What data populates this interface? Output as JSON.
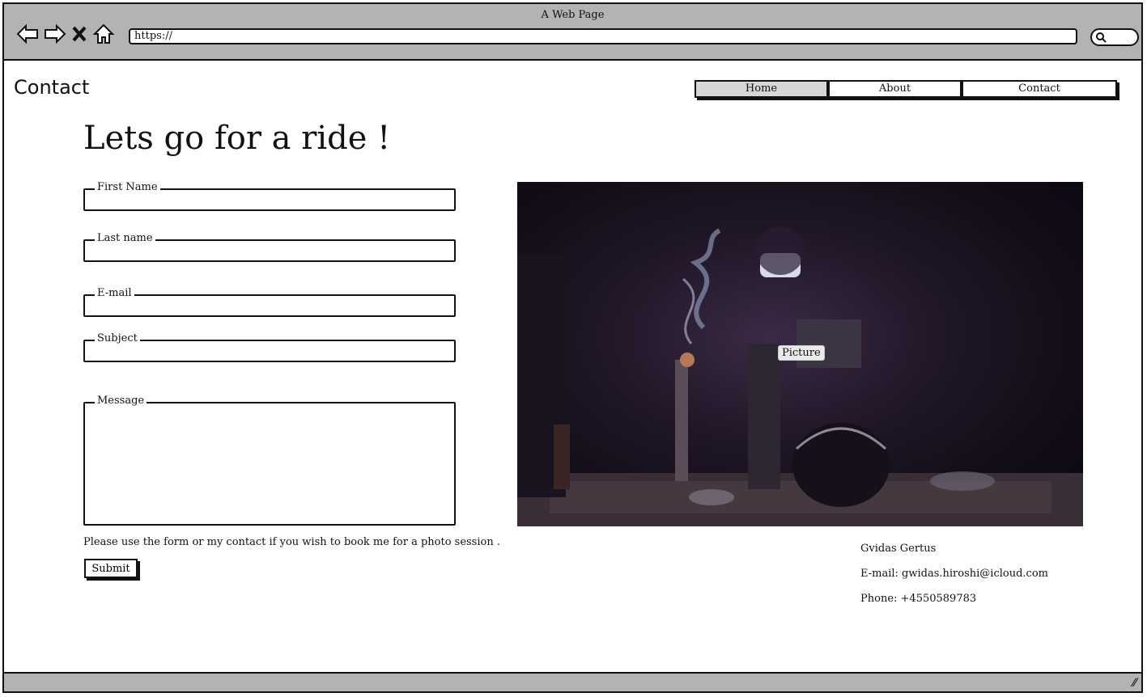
{
  "window": {
    "title": "A Web Page",
    "url": "https://"
  },
  "header": {
    "page_title": "Contact",
    "nav": [
      {
        "label": "Home",
        "active": true
      },
      {
        "label": "About",
        "active": false
      },
      {
        "label": "Contact",
        "active": false
      }
    ]
  },
  "main": {
    "heading": "Lets go for a ride !",
    "form": {
      "first_name_label": "First Name",
      "last_name_label": "Last name",
      "email_label": "E-mail",
      "subject_label": "Subject",
      "message_label": "Message",
      "note": "Please use the form or my contact if you wish to book me for a photo session .",
      "submit_label": "Submit"
    },
    "picture": {
      "label": "Picture"
    },
    "contact": {
      "name": "Gvidas Gertus",
      "email": "E-mail: gwidas.hiroshi@icloud.com",
      "phone": "Phone: +4550589783"
    }
  },
  "colors": {
    "chrome": "#b3b3b3",
    "active_tab": "#d6d6d6",
    "border": "#111111"
  },
  "icons": [
    "back-arrow-icon",
    "forward-arrow-icon",
    "close-icon",
    "home-icon",
    "search-icon",
    "resize-grip-icon"
  ]
}
